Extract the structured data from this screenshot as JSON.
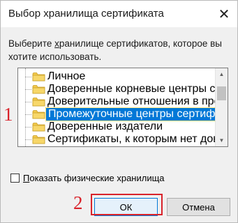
{
  "dialog": {
    "title": "Выбор хранилища сертификата",
    "close_glyph": "✕",
    "prompt_prefix": "Выберите ",
    "prompt_underlined": "х",
    "prompt_rest": "ранилище сертификатов, которое вы хотите использовать."
  },
  "stores": [
    {
      "label": "Личное",
      "selected": false
    },
    {
      "label": "Доверенные корневые центры сертиф",
      "selected": false
    },
    {
      "label": "Доверительные отношения в предпри",
      "selected": false
    },
    {
      "label": "Промежуточные центры сертификаци",
      "selected": true
    },
    {
      "label": "Доверенные издатели",
      "selected": false
    },
    {
      "label": "Сертификаты, к которым нет довери",
      "selected": false
    }
  ],
  "checkbox": {
    "label_underlined": "П",
    "label_rest": "оказать физические хранилища",
    "checked": false
  },
  "buttons": {
    "ok": "ОК",
    "cancel": "Отмена"
  },
  "annotations": {
    "step1": "1",
    "step2": "2"
  },
  "colors": {
    "selection": "#0078d7",
    "annotation": "#d9232b",
    "folder": "#f2c84b"
  }
}
